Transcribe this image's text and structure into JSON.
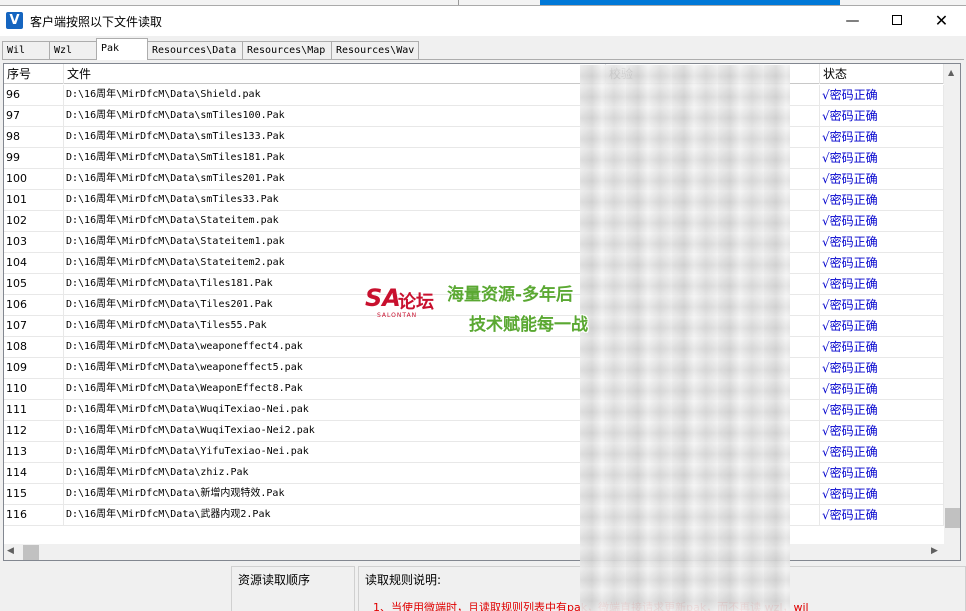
{
  "window": {
    "title": "客户端按照以下文件读取",
    "icon_letter": "V"
  },
  "tabs": [
    {
      "label": "Wil",
      "active": false
    },
    {
      "label": "Wzl",
      "active": false
    },
    {
      "label": "Pak",
      "active": true
    },
    {
      "label": "Resources\\Data",
      "active": false
    },
    {
      "label": "Resources\\Map",
      "active": false
    },
    {
      "label": "Resources\\Wav",
      "active": false
    }
  ],
  "table": {
    "headers": {
      "idx": "序号",
      "file": "文件",
      "hash": "校验",
      "state": "状态"
    },
    "rows": [
      {
        "idx": "96",
        "file": "D:\\16周年\\MirDfcM\\Data\\Shield.pak",
        "state": "√密码正确"
      },
      {
        "idx": "97",
        "file": "D:\\16周年\\MirDfcM\\Data\\smTiles100.Pak",
        "state": "√密码正确"
      },
      {
        "idx": "98",
        "file": "D:\\16周年\\MirDfcM\\Data\\smTiles133.Pak",
        "state": "√密码正确"
      },
      {
        "idx": "99",
        "file": "D:\\16周年\\MirDfcM\\Data\\SmTiles181.Pak",
        "state": "√密码正确"
      },
      {
        "idx": "100",
        "file": "D:\\16周年\\MirDfcM\\Data\\smTiles201.Pak",
        "state": "√密码正确"
      },
      {
        "idx": "101",
        "file": "D:\\16周年\\MirDfcM\\Data\\smTiles33.Pak",
        "state": "√密码正确"
      },
      {
        "idx": "102",
        "file": "D:\\16周年\\MirDfcM\\Data\\Stateitem.pak",
        "state": "√密码正确"
      },
      {
        "idx": "103",
        "file": "D:\\16周年\\MirDfcM\\Data\\Stateitem1.pak",
        "state": "√密码正确"
      },
      {
        "idx": "104",
        "file": "D:\\16周年\\MirDfcM\\Data\\Stateitem2.pak",
        "state": "√密码正确"
      },
      {
        "idx": "105",
        "file": "D:\\16周年\\MirDfcM\\Data\\Tiles181.Pak",
        "state": "√密码正确"
      },
      {
        "idx": "106",
        "file": "D:\\16周年\\MirDfcM\\Data\\Tiles201.Pak",
        "state": "√密码正确"
      },
      {
        "idx": "107",
        "file": "D:\\16周年\\MirDfcM\\Data\\Tiles55.Pak",
        "state": "√密码正确"
      },
      {
        "idx": "108",
        "file": "D:\\16周年\\MirDfcM\\Data\\weaponeffect4.pak",
        "state": "√密码正确"
      },
      {
        "idx": "109",
        "file": "D:\\16周年\\MirDfcM\\Data\\weaponeffect5.pak",
        "state": "√密码正确"
      },
      {
        "idx": "110",
        "file": "D:\\16周年\\MirDfcM\\Data\\WeaponEffect8.Pak",
        "state": "√密码正确"
      },
      {
        "idx": "111",
        "file": "D:\\16周年\\MirDfcM\\Data\\WuqiTexiao-Nei.pak",
        "state": "√密码正确"
      },
      {
        "idx": "112",
        "file": "D:\\16周年\\MirDfcM\\Data\\WuqiTexiao-Nei2.pak",
        "state": "√密码正确"
      },
      {
        "idx": "113",
        "file": "D:\\16周年\\MirDfcM\\Data\\YifuTexiao-Nei.pak",
        "state": "√密码正确"
      },
      {
        "idx": "114",
        "file": "D:\\16周年\\MirDfcM\\Data\\zhiz.Pak",
        "state": "√密码正确"
      },
      {
        "idx": "115",
        "file": "D:\\16周年\\MirDfcM\\Data\\新增内观特效.Pak",
        "state": "√密码正确"
      },
      {
        "idx": "116",
        "file": "D:\\16周年\\MirDfcM\\Data\\武器内观2.Pak",
        "state": "√密码正确"
      }
    ]
  },
  "watermark": {
    "logo_main": "SA",
    "logo_cn": "论坛",
    "logo_sub": "SALONTAN",
    "line1": "海量资源-多年后",
    "line2": "技术赋能每一战"
  },
  "panels": {
    "order_title": "资源读取顺序",
    "rules_title": "读取规则说明:",
    "rule1": "1、当使用微端时，且读取规则列表中有pak，微端直接请求更新pak，而不再读 wzl，wil"
  },
  "colors": {
    "state_ok": "#0000cd",
    "rule_text": "#e00000",
    "tab_border": "#adadad"
  }
}
